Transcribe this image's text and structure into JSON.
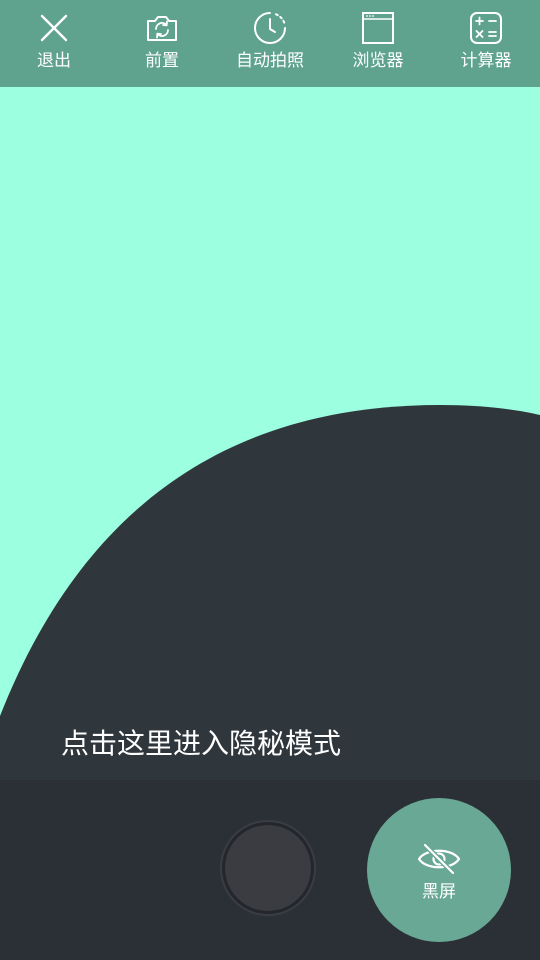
{
  "toolbar": {
    "items": [
      {
        "label": "退出",
        "icon": "close-icon"
      },
      {
        "label": "前置",
        "icon": "camera-switch-icon"
      },
      {
        "label": "自动拍照",
        "icon": "timer-icon"
      },
      {
        "label": "浏览器",
        "icon": "browser-window-icon"
      },
      {
        "label": "计算器",
        "icon": "calculator-icon"
      }
    ]
  },
  "main": {
    "hint_text": "点击这里进入隐秘模式"
  },
  "bottom": {
    "shutter_icon": "shutter-icon",
    "black_screen": {
      "label": "黑屏",
      "icon": "eye-off-icon"
    }
  },
  "colors": {
    "toolbar_bg": "#5fa38f",
    "viewfinder_bg": "#9cffe0",
    "dark_panel": "#2f373d",
    "bottom_bar": "#2b3036",
    "accent_button": "#69a894"
  }
}
